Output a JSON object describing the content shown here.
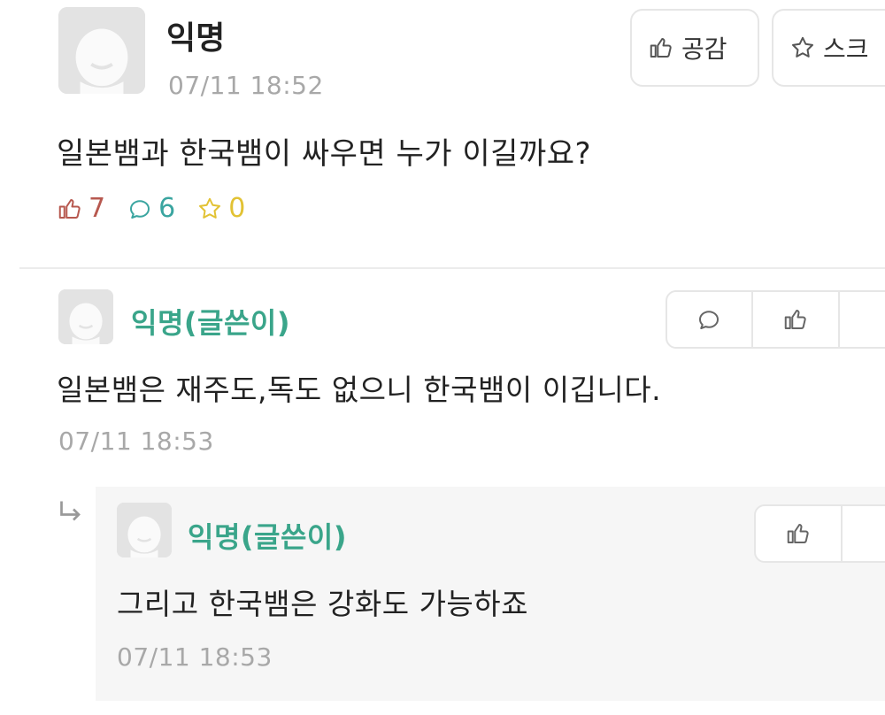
{
  "post": {
    "author": "익명",
    "time": "07/11 18:52",
    "title": "일본뱀과 한국뱀이 싸우면 누가 이길까요?",
    "buttons": {
      "like_label": "공감",
      "scrap_label": "스크"
    },
    "stats": {
      "likes": "7",
      "comments": "6",
      "scraps": "0"
    }
  },
  "comments": [
    {
      "author": "익명(글쓴이)",
      "text": "일본뱀은 재주도,독도 없으니 한국뱀이 이깁니다.",
      "time": "07/11 18:53"
    }
  ],
  "reply": {
    "author": "익명(글쓴이)",
    "text": "그리고 한국뱀은 강화도 가능하죠",
    "time": "07/11 18:53"
  },
  "colors": {
    "accent_green": "#3aa58a",
    "like_red": "#b7584f",
    "comment_teal": "#3aa5a0",
    "scrap_yellow": "#e2c233",
    "muted_gray": "#a8a8a8"
  },
  "icons": [
    "avatar-icon",
    "thumbs-up-icon",
    "star-icon",
    "speech-bubble-icon",
    "reply-arrow-icon"
  ]
}
